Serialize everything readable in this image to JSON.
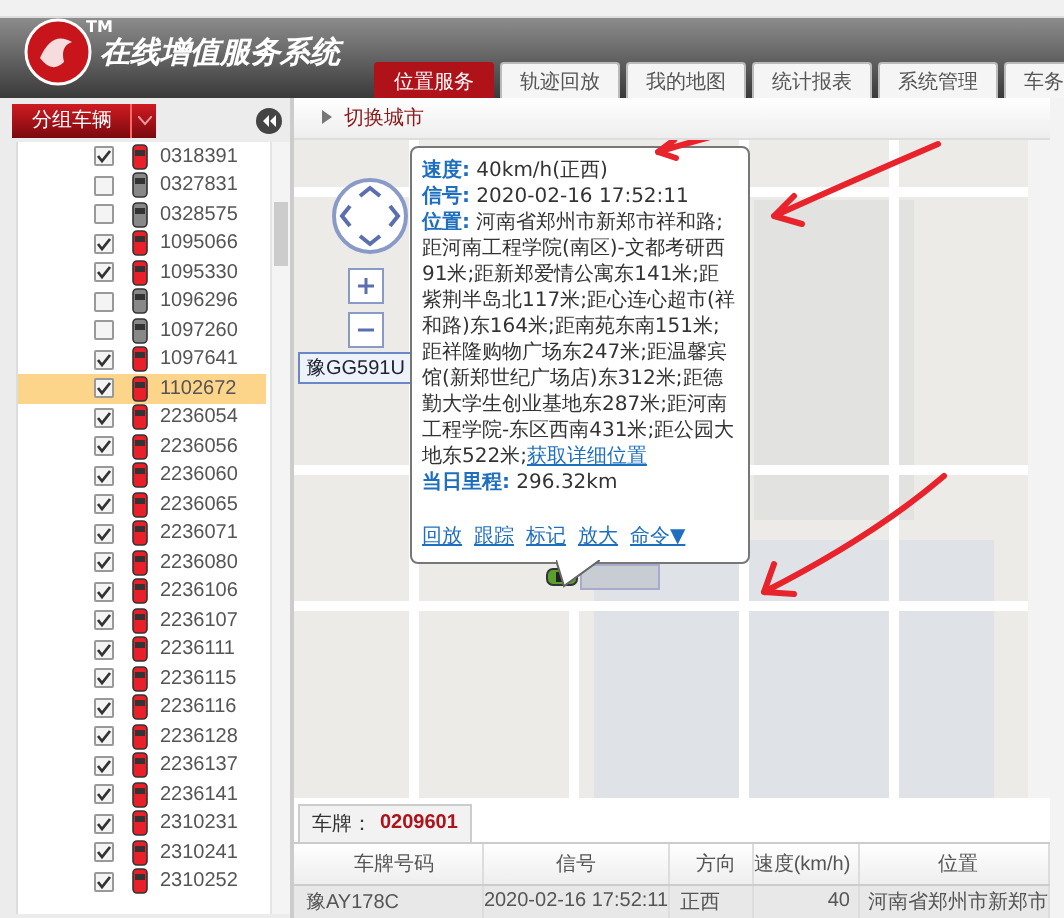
{
  "header": {
    "title": "在线增值服务系统",
    "logo_mark": "TM"
  },
  "tabs": [
    {
      "label": "位置服务",
      "selected": true
    },
    {
      "label": "轨迹回放",
      "selected": false
    },
    {
      "label": "我的地图",
      "selected": false
    },
    {
      "label": "统计报表",
      "selected": false
    },
    {
      "label": "系统管理",
      "selected": false
    },
    {
      "label": "车务",
      "selected": false
    }
  ],
  "sidebar": {
    "group_button": "分组车辆",
    "vehicles": [
      {
        "id": "0318391",
        "checked": true,
        "online": true,
        "selected": false
      },
      {
        "id": "0327831",
        "checked": false,
        "online": false,
        "selected": false
      },
      {
        "id": "0328575",
        "checked": false,
        "online": false,
        "selected": false
      },
      {
        "id": "1095066",
        "checked": true,
        "online": true,
        "selected": false
      },
      {
        "id": "1095330",
        "checked": true,
        "online": true,
        "selected": false
      },
      {
        "id": "1096296",
        "checked": false,
        "online": false,
        "selected": false
      },
      {
        "id": "1097260",
        "checked": false,
        "online": false,
        "selected": false
      },
      {
        "id": "1097641",
        "checked": true,
        "online": true,
        "selected": false
      },
      {
        "id": "1102672",
        "checked": true,
        "online": true,
        "selected": true
      },
      {
        "id": "2236054",
        "checked": true,
        "online": true,
        "selected": false
      },
      {
        "id": "2236056",
        "checked": true,
        "online": true,
        "selected": false
      },
      {
        "id": "2236060",
        "checked": true,
        "online": true,
        "selected": false
      },
      {
        "id": "2236065",
        "checked": true,
        "online": true,
        "selected": false
      },
      {
        "id": "2236071",
        "checked": true,
        "online": true,
        "selected": false
      },
      {
        "id": "2236080",
        "checked": true,
        "online": true,
        "selected": false
      },
      {
        "id": "2236106",
        "checked": true,
        "online": true,
        "selected": false
      },
      {
        "id": "2236107",
        "checked": true,
        "online": true,
        "selected": false
      },
      {
        "id": "2236111",
        "checked": true,
        "online": true,
        "selected": false
      },
      {
        "id": "2236115",
        "checked": true,
        "online": true,
        "selected": false
      },
      {
        "id": "2236116",
        "checked": true,
        "online": true,
        "selected": false
      },
      {
        "id": "2236128",
        "checked": true,
        "online": true,
        "selected": false
      },
      {
        "id": "2236137",
        "checked": true,
        "online": true,
        "selected": false
      },
      {
        "id": "2236141",
        "checked": true,
        "online": true,
        "selected": false
      },
      {
        "id": "2310231",
        "checked": true,
        "online": true,
        "selected": false
      },
      {
        "id": "2310241",
        "checked": true,
        "online": true,
        "selected": false
      },
      {
        "id": "2310252",
        "checked": true,
        "online": true,
        "selected": false
      }
    ]
  },
  "toolbar": {
    "switch_city": "切换城市"
  },
  "map": {
    "vehicle_label": "豫GG591U",
    "popup": {
      "lines": [
        "**速度:** 40km/h(正西)",
        "**信号:** 2020-02-16 17:52:11"
      ],
      "location": "**位置:** 河南省郑州市新郑市祥和路;距河南工程学院(南区)-文都考研西91米;距新郑爱情公寓东141米;距紫荆半岛北117米;距心连心超市(祥和路)东164米;距南苑东南151米;距祥隆购物广场东247米;距温馨宾馆(新郑世纪广场店)东312米;距德勤大学生创业基地东287米;距河南工程学院-东区西南431米;距公园大地东522米;",
      "detail_link": "获取详细位置",
      "mileage": "**当日里程:** 296.32km",
      "actions": [
        "回放",
        "跟踪",
        "标记",
        "放大",
        "命令▼"
      ]
    }
  },
  "plate": {
    "label": "车牌：",
    "value": "0209601"
  },
  "table": {
    "columns": [
      "车牌号码",
      "信号",
      "方向",
      "速度(km/h)",
      "位置"
    ],
    "rows": [
      [
        "豫AY178C",
        "2020-02-16 17:52:11",
        "正西",
        "40",
        "河南省郑州市新郑市"
      ]
    ]
  }
}
